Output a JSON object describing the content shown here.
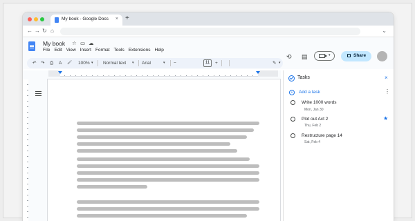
{
  "browser": {
    "tab_title": "My book - Google Docs",
    "tab_close": "×",
    "new_tab": "+",
    "nav": {
      "back": "←",
      "forward": "→",
      "reload": "↻",
      "home": "⌂"
    },
    "menu": "⌄"
  },
  "docs": {
    "title": "My book",
    "menus": [
      "File",
      "Edit",
      "View",
      "Insert",
      "Format",
      "Tools",
      "Extensions",
      "Help"
    ],
    "share_label": "Share",
    "icons": {
      "history": "⟲",
      "comment": "▤",
      "star": "☆",
      "folder": "▭",
      "cloud": "☁"
    }
  },
  "toolbar": {
    "zoom": "100%",
    "style": "Normal text",
    "font": "Arial",
    "font_size": "11",
    "minus": "−",
    "plus": "+",
    "caret": "▾",
    "undo": "↶",
    "redo": "↷",
    "print": "⎙",
    "spell": "A",
    "paint": "🖌",
    "pencil": "✎"
  },
  "tasks": {
    "title": "Tasks",
    "add_label": "Add a task",
    "close": "×",
    "kebab": "⋮",
    "items": [
      {
        "title": "Write 1000 words",
        "date": "Mon, Jan 30",
        "starred": false
      },
      {
        "title": "Plot out Act 2",
        "date": "Thu, Feb 2",
        "starred": true
      },
      {
        "title": "Restructure page 14",
        "date": "Sat, Feb 4",
        "starred": false
      }
    ],
    "star_glyph": "★"
  },
  "colors": {
    "accent": "#1a73e8",
    "share_bg": "#c2e7ff",
    "toolbar_bg": "#edf2fa"
  }
}
